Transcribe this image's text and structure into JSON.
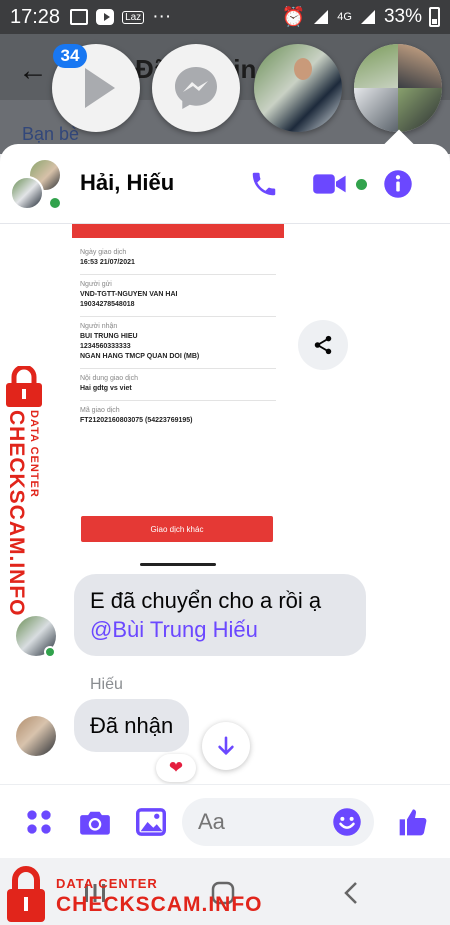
{
  "status_bar": {
    "time": "17:28",
    "carrier_badge": "Laz",
    "network": "4G",
    "battery": "33%"
  },
  "background_app": {
    "title": "Đã gửi tin nhắn",
    "link": "Bạn bè"
  },
  "chat_heads": {
    "badge_count": "34"
  },
  "chat": {
    "name": "Hải, Hiếu"
  },
  "receipt": {
    "label_date": "Ngày giao dịch",
    "date": "16:53 21/07/2021",
    "label_sender": "Người gửi",
    "sender_name": "VND-TGTT-NGUYEN VAN HAI",
    "sender_account": "19034278548018",
    "label_receiver": "Người nhận",
    "receiver_name": "BUI TRUNG HIEU",
    "receiver_account": "1234560333333",
    "receiver_bank": "NGAN HANG TMCP QUAN DOI (MB)",
    "label_content": "Nội dung giao dịch",
    "content": "Hai gdtg vs viet",
    "label_code": "Mã giao dịch",
    "code": "FT21202160803075 (54223769195)",
    "button": "Giao dịch khác"
  },
  "messages": [
    {
      "text": "E đã chuyển cho a rồi ạ",
      "mention": "@Bùi Trung Hiếu"
    },
    {
      "sender": "Hiếu",
      "text": "Đã nhận",
      "reaction": "❤"
    }
  ],
  "composer": {
    "placeholder": "Aa"
  },
  "watermark": {
    "brand": "CHECKSCAM.INFO",
    "sub": "DATA CENTER"
  },
  "colors": {
    "accent": "#6b48ff",
    "online": "#31a24c",
    "watermark": "#e1251b",
    "receipt_red": "#e53935"
  }
}
